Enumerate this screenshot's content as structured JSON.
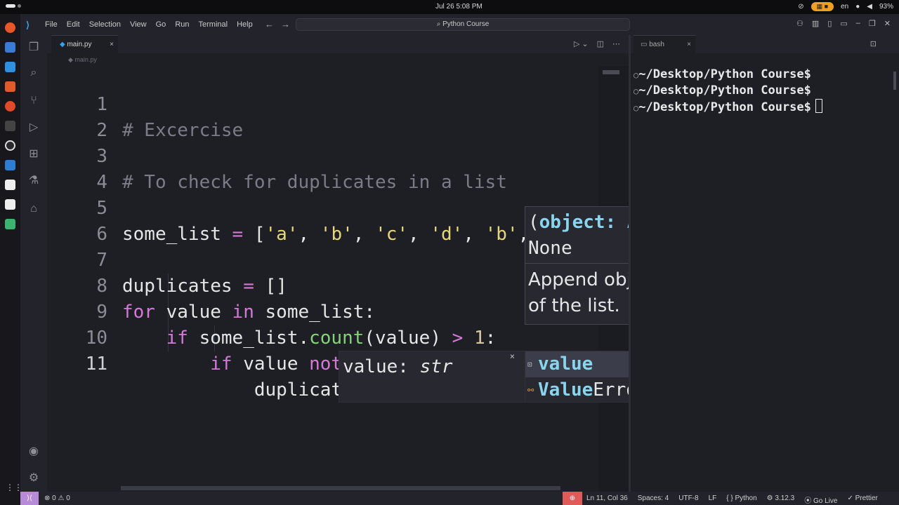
{
  "system_bar": {
    "clock": "Jul 26  5:08 PM",
    "lang": "en",
    "battery": "93%"
  },
  "titlebar": {
    "menu": [
      "File",
      "Edit",
      "Selection",
      "View",
      "Go",
      "Run",
      "Terminal",
      "Help"
    ],
    "search": "Python Course"
  },
  "tab": {
    "label": "main.py",
    "close": "×"
  },
  "breadcrumb": "main.py",
  "editor": {
    "line_numbers": [
      "1",
      "2",
      "3",
      "4",
      "5",
      "6",
      "7",
      "8",
      "9",
      "10",
      "11"
    ],
    "active_line": "11"
  },
  "hover": {
    "sig_open": "(",
    "sig_param": "object: Any",
    "sig_rest": ", /) -> None",
    "doc": "Append object to the end of the list."
  },
  "param_hint": {
    "name": "value: ",
    "type": "str",
    "close": "×"
  },
  "suggestions": [
    {
      "match": "value",
      "rest": "",
      "icon": "variable-icon"
    },
    {
      "match": "Value",
      "rest": "Error",
      "icon": "class-icon"
    }
  ],
  "terminal": {
    "tab_label": "bash",
    "lines": [
      "~/Desktop/Python Course$",
      "~/Desktop/Python Course$",
      "~/Desktop/Python Course$"
    ]
  },
  "status": {
    "problems": "⊗ 0 ⚠ 0",
    "position": "Ln 11, Col 36",
    "spaces": "Spaces: 4",
    "encoding": "UTF-8",
    "eol": "LF",
    "language": "Python",
    "version": "3.12.3",
    "golive": "Go Live",
    "prettier": "Prettier"
  },
  "colors": {
    "keyword": "#d579d8",
    "string": "#e6d87a",
    "function": "#86d27a",
    "comment": "#7a7d87",
    "accent": "#8ad4ee"
  }
}
